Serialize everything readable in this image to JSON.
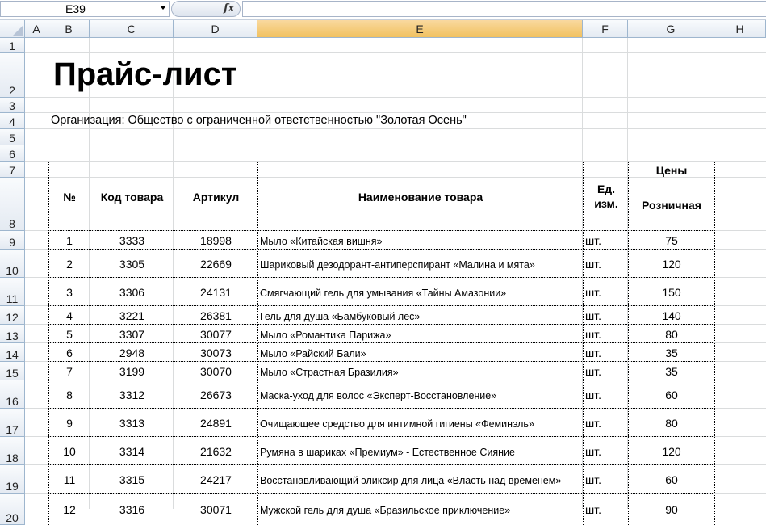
{
  "formula_bar": {
    "name_box": "E39",
    "fx": "fx",
    "formula": ""
  },
  "columns": [
    "A",
    "B",
    "C",
    "D",
    "E",
    "F",
    "G",
    "H"
  ],
  "rows": [
    "1",
    "2",
    "3",
    "4",
    "5",
    "6",
    "7",
    "8",
    "9",
    "10",
    "11",
    "12",
    "13",
    "14",
    "15",
    "16",
    "17",
    "18",
    "19",
    "20"
  ],
  "sheet": {
    "title": "Прайс-лист",
    "org": "Организация: Общество с ограниченной ответственностью \"Золотая Осень\"",
    "headers": {
      "num": "№",
      "code": "Код товара",
      "article": "Артикул",
      "name": "Наименование товара",
      "unit": "Ед. изм.",
      "prices": "Цены",
      "retail": "Розничная"
    },
    "items": [
      {
        "n": "1",
        "code": "3333",
        "art": "18998",
        "name": "Мыло «Китайская вишня»",
        "unit": "шт.",
        "price": "75"
      },
      {
        "n": "2",
        "code": "3305",
        "art": "22669",
        "name": "Шариковый дезодорант-антиперспирант «Малина и мята»",
        "unit": "шт.",
        "price": "120"
      },
      {
        "n": "3",
        "code": "3306",
        "art": "24131",
        "name": "Смягчающий гель для умывания «Тайны Амазонии»",
        "unit": "шт.",
        "price": "150"
      },
      {
        "n": "4",
        "code": "3221",
        "art": "26381",
        "name": "Гель для душа «Бамбуковый лес»",
        "unit": "шт.",
        "price": "140"
      },
      {
        "n": "5",
        "code": "3307",
        "art": "30077",
        "name": "Мыло «Романтика Парижа»",
        "unit": "шт.",
        "price": "80"
      },
      {
        "n": "6",
        "code": "2948",
        "art": "30073",
        "name": "Мыло «Райский Бали»",
        "unit": "шт.",
        "price": "35"
      },
      {
        "n": "7",
        "code": "3199",
        "art": "30070",
        "name": "Мыло «Страстная Бразилия»",
        "unit": "шт.",
        "price": "35"
      },
      {
        "n": "8",
        "code": "3312",
        "art": "26673",
        "name": "Маска-уход для волос «Эксперт-Восстановление»",
        "unit": "шт.",
        "price": "60"
      },
      {
        "n": "9",
        "code": "3313",
        "art": "24891",
        "name": "Очищающее средство для интимной гигиены «Феминэль»",
        "unit": "шт.",
        "price": "80"
      },
      {
        "n": "10",
        "code": "3314",
        "art": "21632",
        "name": "Румяна в шариках «Премиум» - Естественное Сияние",
        "unit": "шт.",
        "price": "120"
      },
      {
        "n": "11",
        "code": "3315",
        "art": "24217",
        "name": "Восстанавливающий эликсир для лица «Власть над временем»",
        "unit": "шт.",
        "price": "60"
      },
      {
        "n": "12",
        "code": "3316",
        "art": "30071",
        "name": "Мужской гель для душа «Бразильское приключение»",
        "unit": "шт.",
        "price": "90"
      }
    ]
  }
}
